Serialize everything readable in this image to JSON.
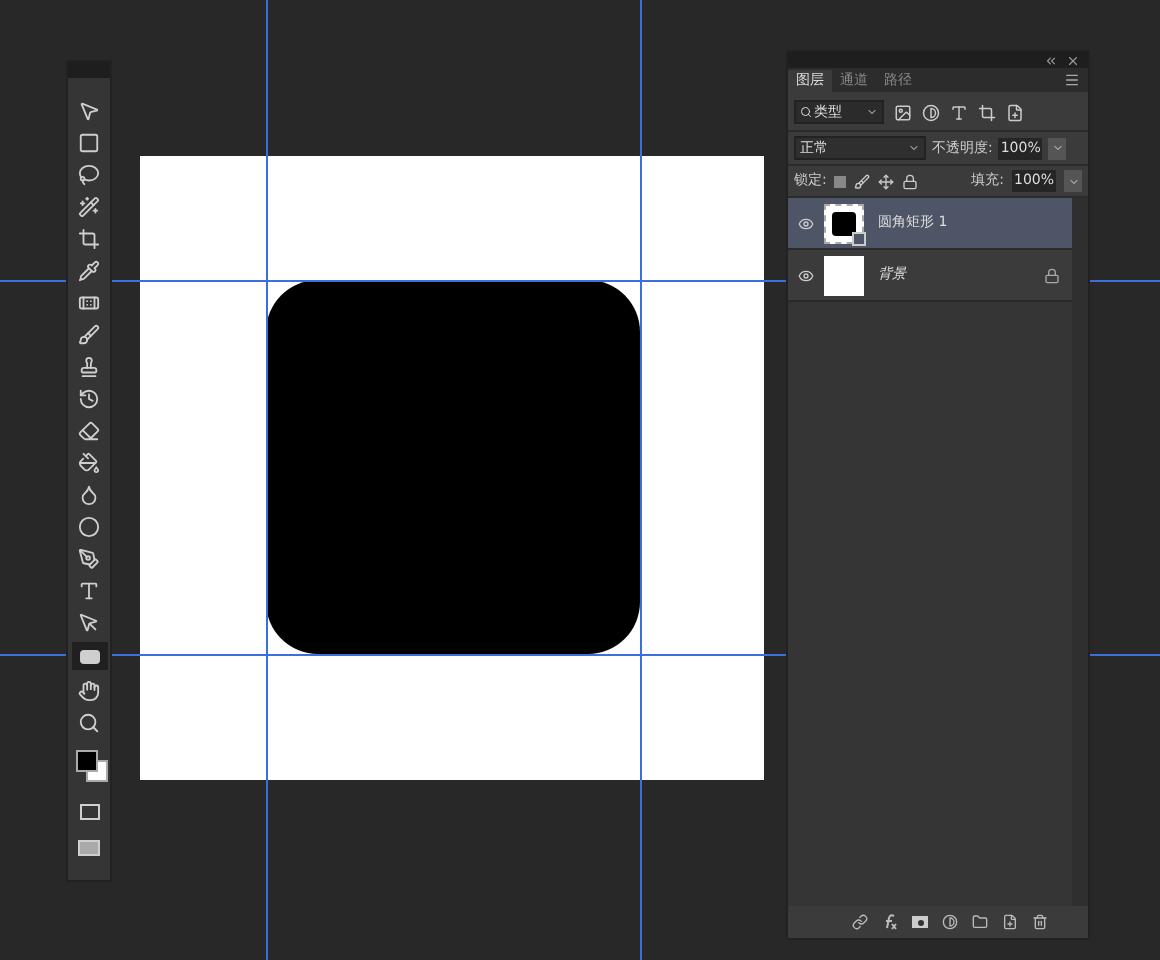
{
  "layers_panel": {
    "tabs": [
      {
        "label": "图层",
        "selected": true
      },
      {
        "label": "通道",
        "selected": false
      },
      {
        "label": "路径",
        "selected": false
      }
    ],
    "filter": {
      "value": "类型"
    },
    "blend_mode": {
      "value": "正常"
    },
    "opacity": {
      "label": "不透明度:",
      "value": "100%"
    },
    "lock": {
      "label": "锁定:"
    },
    "fill": {
      "label": "填充:",
      "value": "100%"
    },
    "layers": [
      {
        "name": "圆角矩形 1",
        "kind": "shape",
        "visible": true,
        "selected": true,
        "locked": false
      },
      {
        "name": "背景",
        "kind": "background",
        "visible": true,
        "selected": false,
        "locked": true
      }
    ]
  }
}
